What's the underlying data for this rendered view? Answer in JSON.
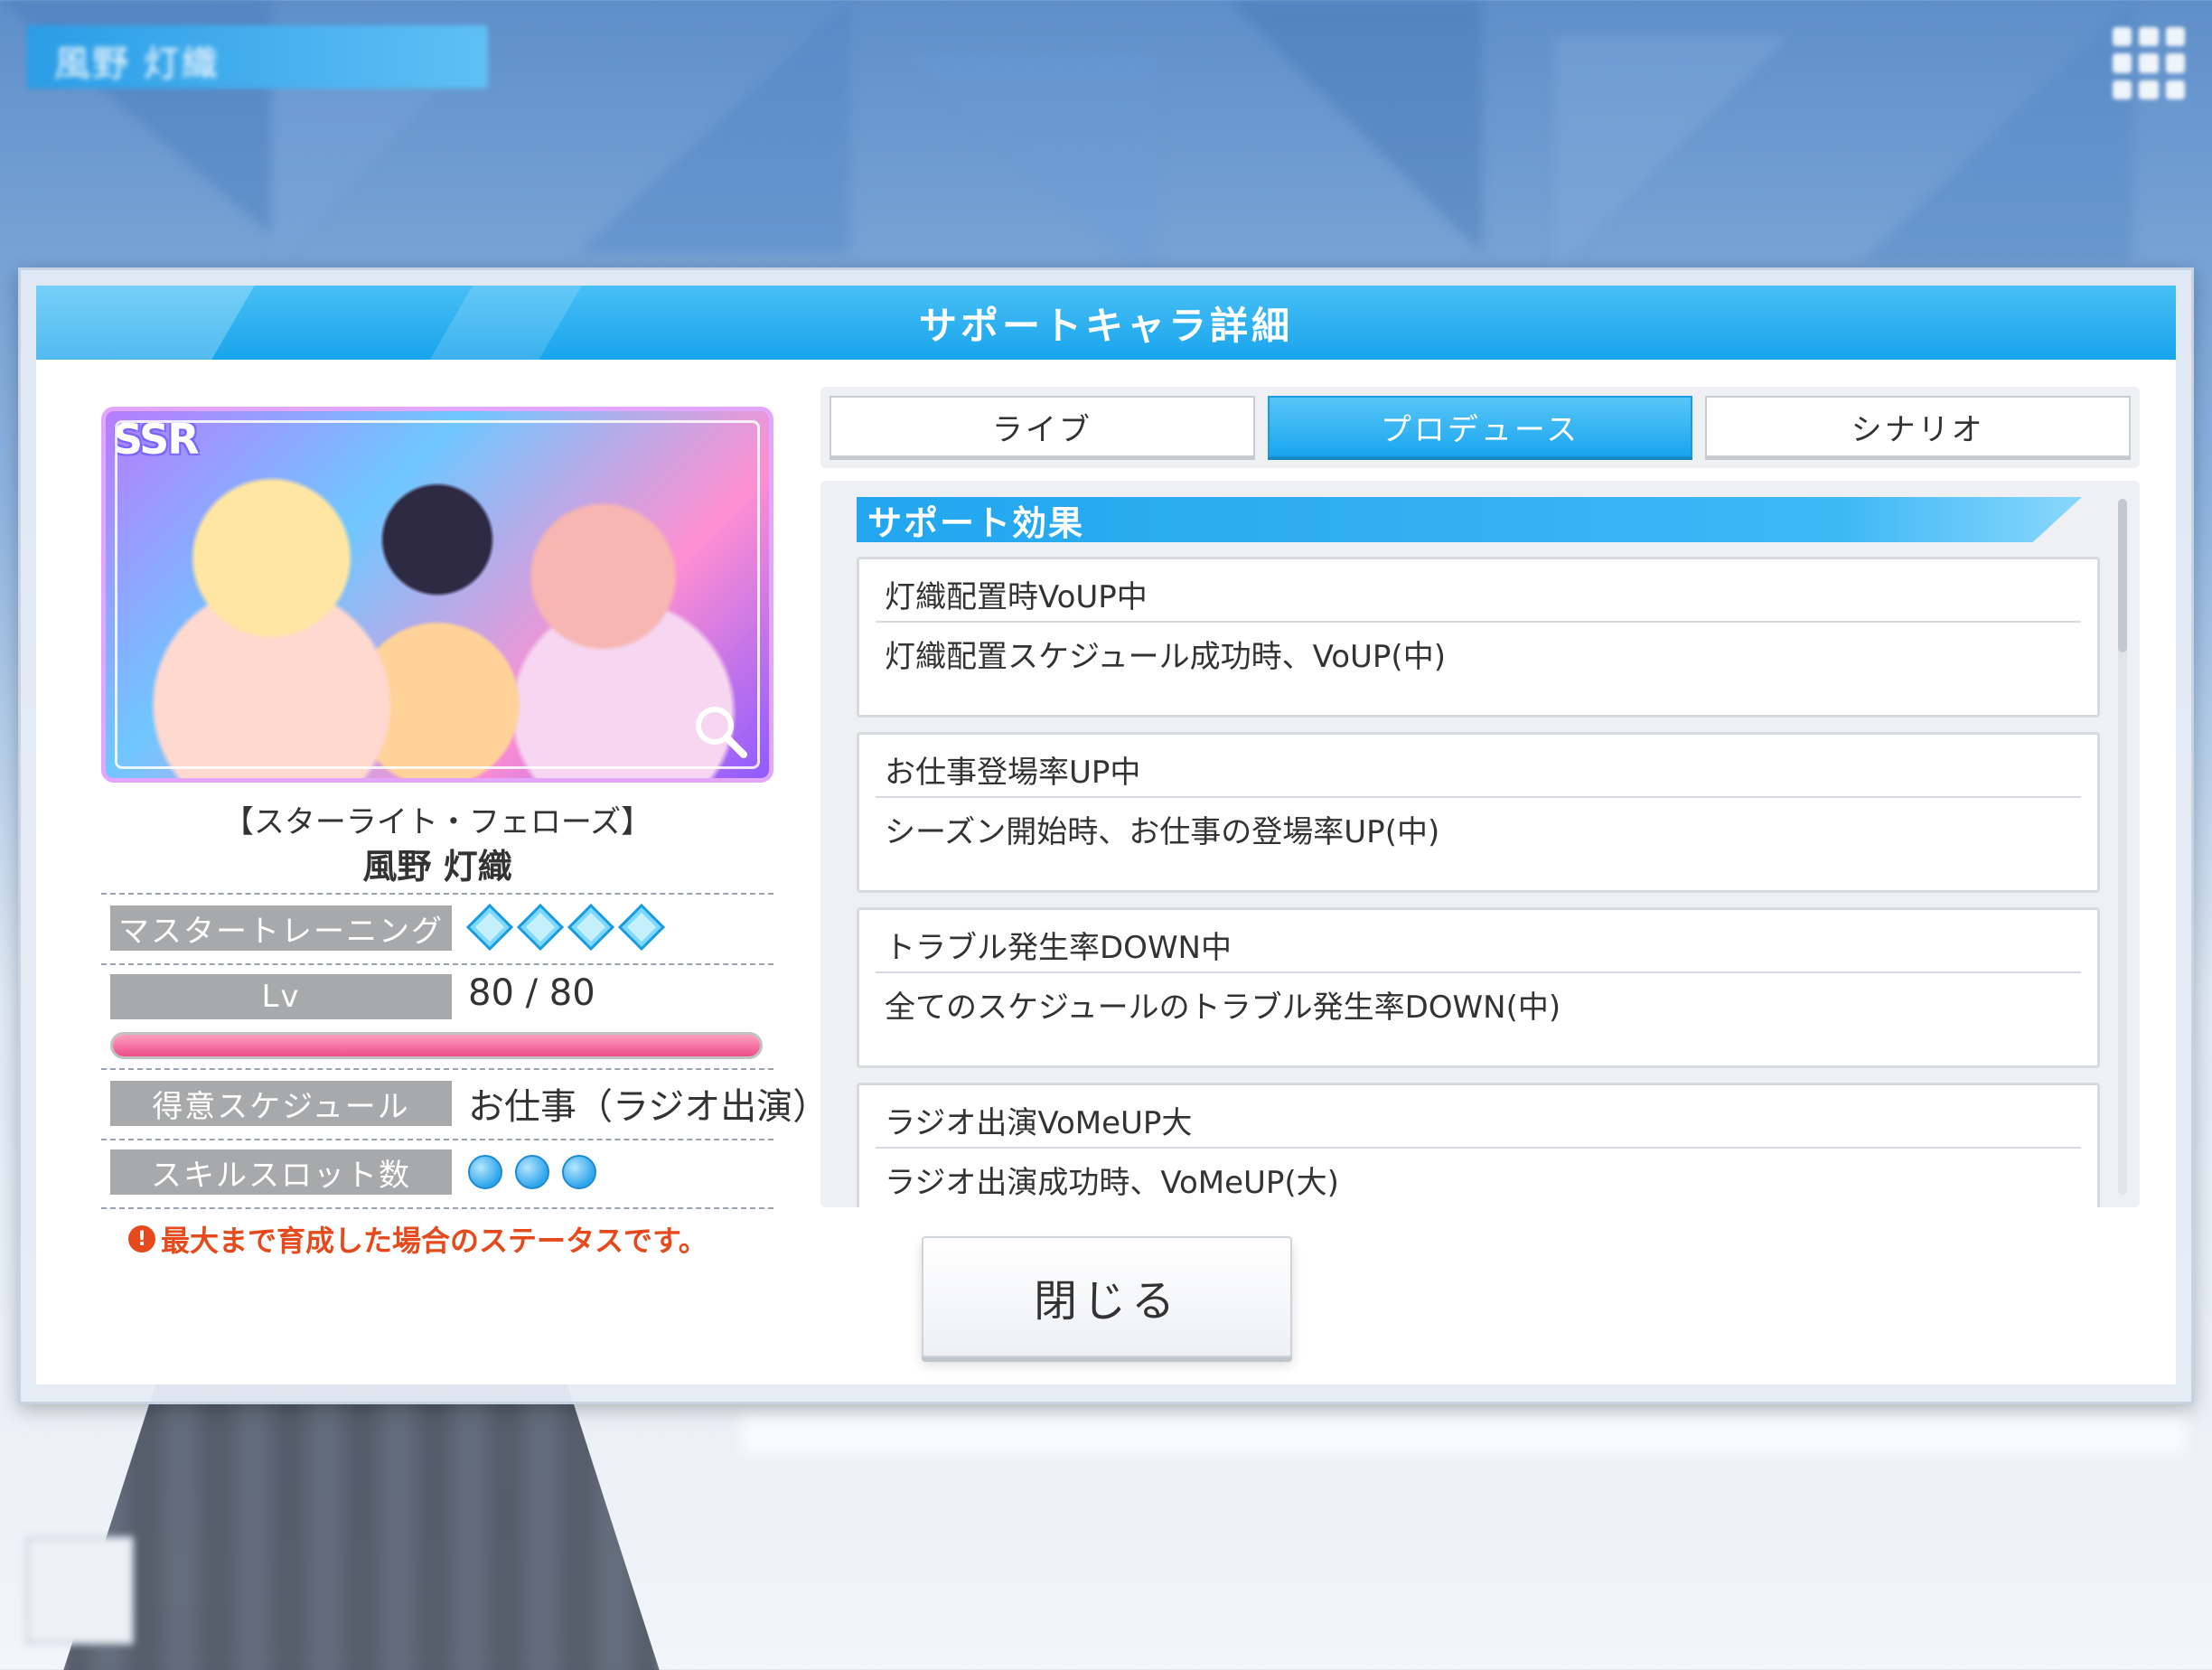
{
  "background": {
    "name_bar": "風野 灯織"
  },
  "dialog": {
    "title": "サポートキャラ詳細"
  },
  "card": {
    "rarity": "SSR",
    "title": "【スターライト・フェローズ】",
    "name": "風野 灯織",
    "accent_color": "#e3a6ff"
  },
  "stats": {
    "master_training_label": "マスタートレーニング",
    "master_training_level": 4,
    "lv_label": "Lv",
    "lv_value": "80 / 80",
    "lv_progress": 1.0,
    "schedule_label": "得意スケジュール",
    "schedule_value": "お仕事（ラジオ出演）",
    "skill_slot_label": "スキルスロット数",
    "skill_slots": 3
  },
  "warning": {
    "icon": "!",
    "text": "最大まで育成した場合のステータスです。"
  },
  "tabs": [
    {
      "label": "ライブ",
      "active": false
    },
    {
      "label": "プロデュース",
      "active": true
    },
    {
      "label": "シナリオ",
      "active": false
    }
  ],
  "effects": {
    "header": "サポート効果",
    "items": [
      {
        "title": "灯織配置時VoUP中",
        "desc": "灯織配置スケジュール成功時、VoUP(中)"
      },
      {
        "title": "お仕事登場率UP中",
        "desc": "シーズン開始時、お仕事の登場率UP(中)"
      },
      {
        "title": "トラブル発生率DOWN中",
        "desc": "全てのスケジュールのトラブル発生率DOWN(中)"
      },
      {
        "title": "ラジオ出演VoMeUP大",
        "desc": "ラジオ出演成功時、VoMeUP(大)"
      }
    ]
  },
  "buttons": {
    "close": "閉じる"
  },
  "colors": {
    "accent": "#1aa6ee",
    "warning": "#e64a1c",
    "hp": "#ec4d8a"
  }
}
